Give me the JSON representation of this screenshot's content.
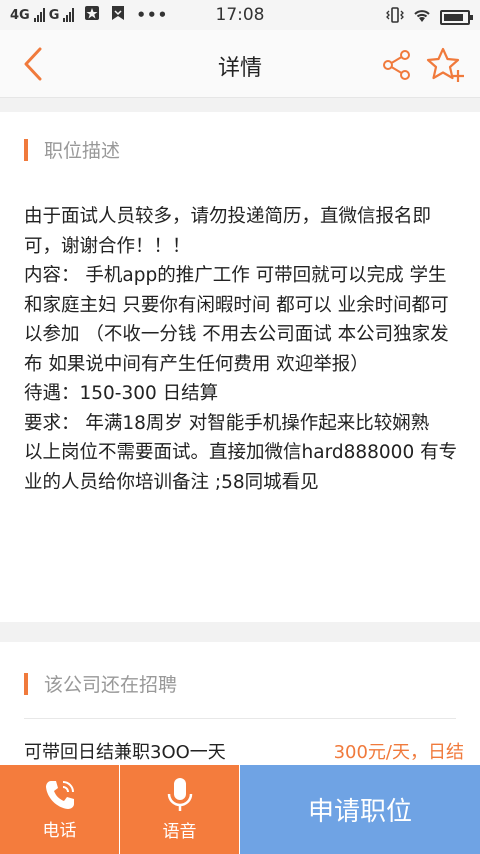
{
  "status_bar": {
    "network_1": "4G",
    "network_2": "G",
    "time": "17:08",
    "battery_level": 0.85
  },
  "nav": {
    "title": "详情"
  },
  "description": {
    "heading": "职位描述",
    "body": "由于面试人员较多，请勿投递简历，直微信报名即可，谢谢合作！！！\n内容： 手机app的推广工作 可带回就可以完成 学生 和家庭主妇 只要你有闲暇时间 都可以 业余时间都可以参加 （不收一分钱 不用去公司面试 本公司独家发布 如果说中间有产生任何费用 欢迎举报）\n待遇：150-300 日结算\n要求： 年满18周岁 对智能手机操作起来比较娴熟\n以上岗位不需要面试。直接加微信hard888000 有专业的人员给你培训备注 ;58同城看见"
  },
  "other_jobs": {
    "heading": "该公司还在招聘",
    "items": [
      {
        "title": "可带回日结兼职3OO一天",
        "pay": "300元/天，日结"
      }
    ]
  },
  "bottom": {
    "call_label": "电话",
    "voice_label": "语音",
    "apply_label": "申请职位"
  },
  "colors": {
    "accent": "#f07a3c",
    "apply": "#6fa3e4"
  }
}
